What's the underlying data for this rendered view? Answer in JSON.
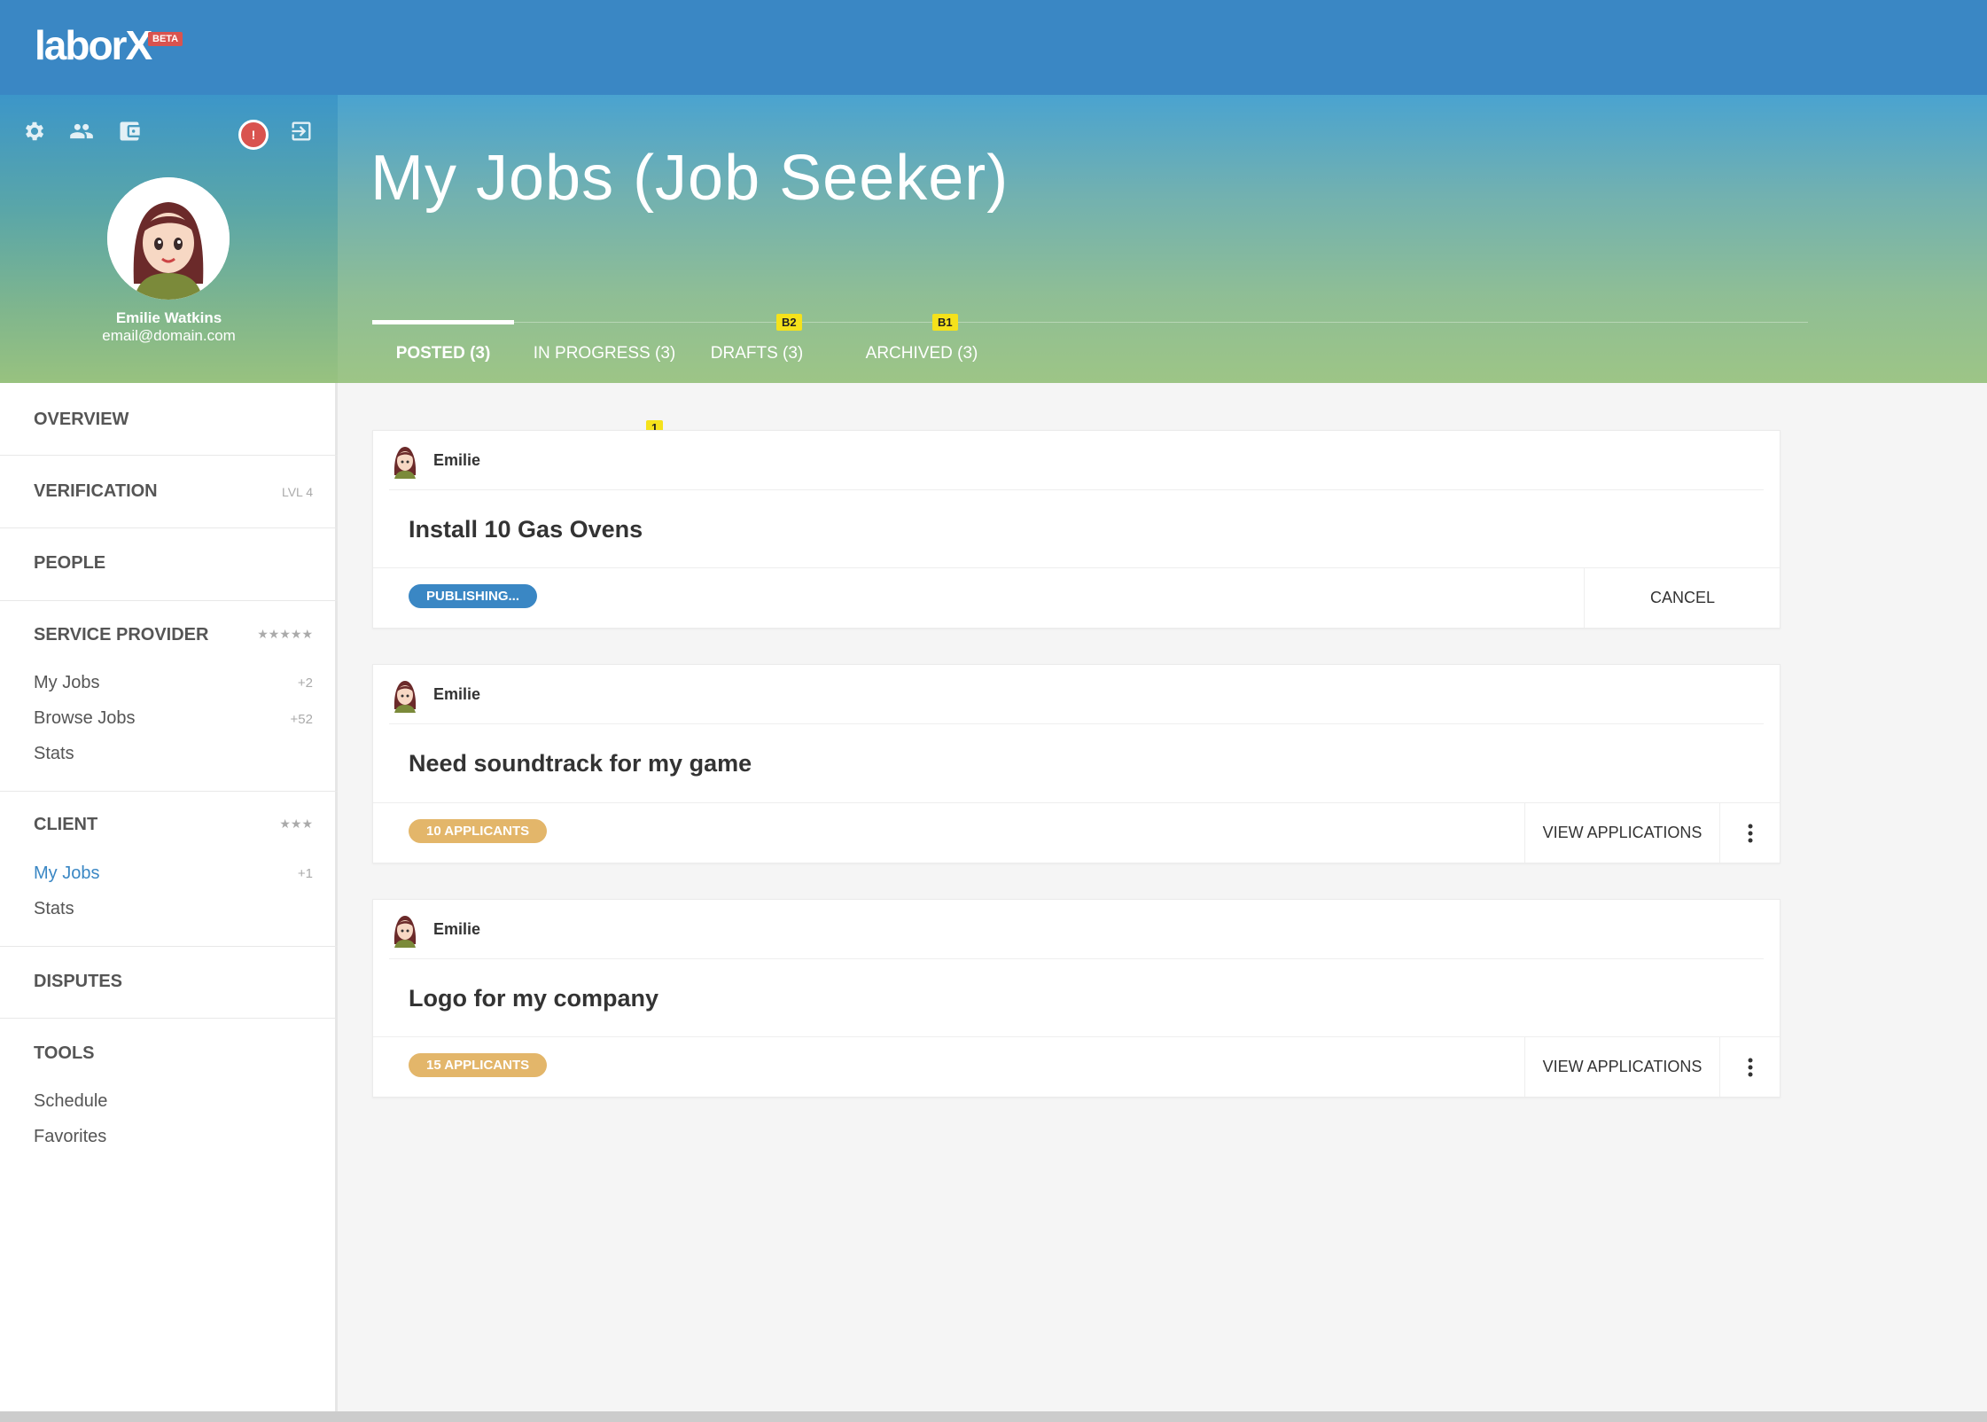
{
  "app": {
    "logo_text": "laborX",
    "beta_label": "BETA"
  },
  "profile": {
    "name": "Emilie Watkins",
    "email": "email@domain.com",
    "alert_glyph": "!"
  },
  "page": {
    "title": "My Jobs (Job Seeker)"
  },
  "tabs": [
    {
      "label": "POSTED (3)",
      "active": true,
      "badge": ""
    },
    {
      "label": "IN PROGRESS (3)",
      "active": false,
      "badge": ""
    },
    {
      "label": "DRAFTS (3)",
      "active": false,
      "badge": "B2"
    },
    {
      "label": "ARCHIVED (3)",
      "active": false,
      "badge": "B1"
    }
  ],
  "sidebar": {
    "overview": "OVERVIEW",
    "verification": "VERIFICATION",
    "verification_level": "LVL 4",
    "people": "PEOPLE",
    "service_provider": "SERVICE PROVIDER",
    "service_provider_rating": "★★★★★",
    "sp_items": [
      {
        "label": "My Jobs",
        "count": "+2"
      },
      {
        "label": "Browse Jobs",
        "count": "+52"
      },
      {
        "label": "Stats",
        "count": ""
      }
    ],
    "client": "CLIENT",
    "client_rating": "★★★",
    "client_items": [
      {
        "label": "My Jobs",
        "count": "+1"
      },
      {
        "label": "Stats",
        "count": ""
      }
    ],
    "disputes": "DISPUTES",
    "tools": "TOOLS",
    "tool_items": [
      {
        "label": "Schedule"
      },
      {
        "label": "Favorites"
      }
    ]
  },
  "marker_1": "1",
  "jobs": [
    {
      "author": "Emilie",
      "title": "Install 10 Gas Ovens",
      "status": "PUBLISHING...",
      "action": "CANCEL"
    },
    {
      "author": "Emilie",
      "title": "Need soundtrack for my game",
      "status": "10 APPLICANTS",
      "action": "VIEW APPLICATIONS"
    },
    {
      "author": "Emilie",
      "title": "Logo for my company",
      "status": "15 APPLICANTS",
      "action": "VIEW APPLICATIONS"
    }
  ],
  "colors": {
    "primary": "#3a87c4",
    "alert": "#d9534f",
    "applicants": "#e3b66a",
    "marker": "#f5e21b"
  },
  "icons": [
    "settings-icon",
    "people-icon",
    "wallet-icon",
    "alert-icon",
    "logout-icon",
    "more-vert-icon"
  ]
}
